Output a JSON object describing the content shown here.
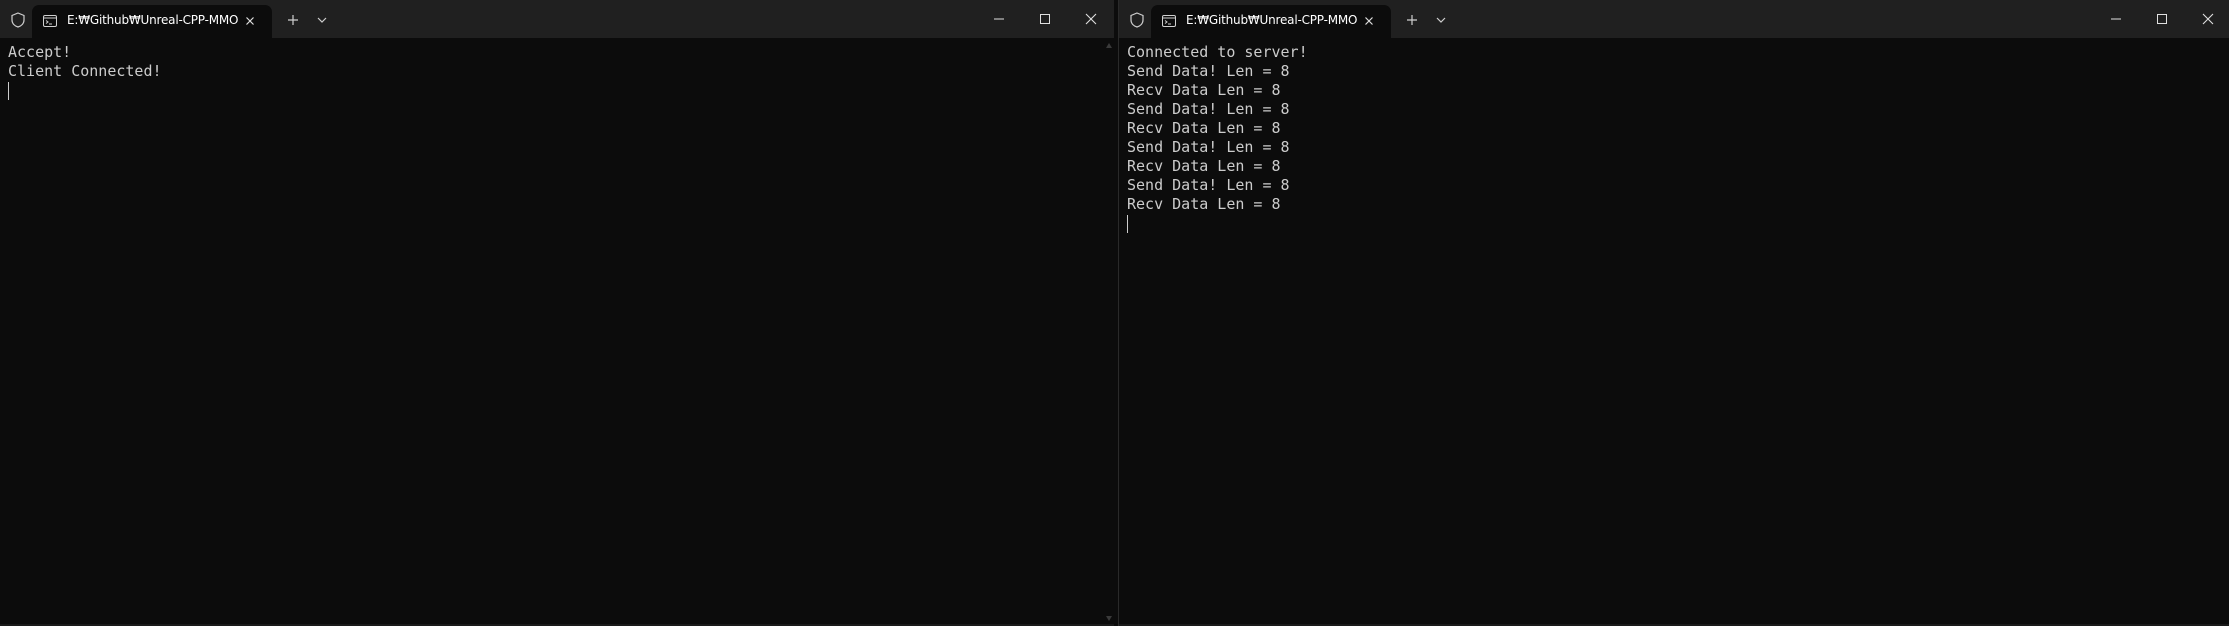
{
  "windows": [
    {
      "tab_title": "E:₩Github₩Unreal-CPP-MMO",
      "lines": [
        "Accept!",
        "Client Connected!"
      ]
    },
    {
      "tab_title": "E:₩Github₩Unreal-CPP-MMO",
      "lines": [
        "Connected to server!",
        "Send Data! Len = 8",
        "Recv Data Len = 8",
        "Send Data! Len = 8",
        "Recv Data Len = 8",
        "Send Data! Len = 8",
        "Recv Data Len = 8",
        "Send Data! Len = 8",
        "Recv Data Len = 8"
      ]
    }
  ],
  "colors": {
    "titlebar": "#202020",
    "background": "#0c0c0c",
    "text": "#cccccc",
    "tab_text": "#ffffff"
  },
  "icons": [
    "shield-icon",
    "terminal-icon",
    "close-icon",
    "plus-icon",
    "chevron-down-icon",
    "minimize-icon",
    "maximize-icon",
    "close-window-icon"
  ]
}
